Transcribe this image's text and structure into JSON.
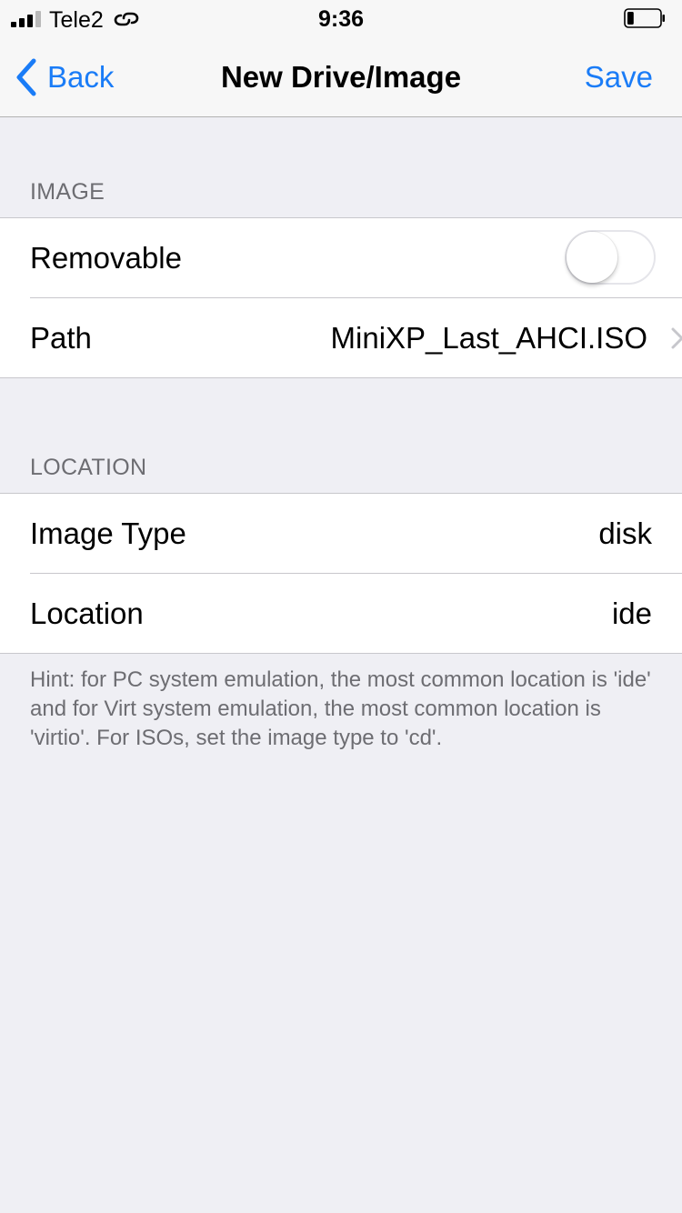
{
  "status_bar": {
    "carrier": "Tele2",
    "time": "9:36",
    "signal_bars": 4,
    "signal_active": 3,
    "battery_level": 0.2,
    "icons": [
      "signal-icon",
      "link-icon",
      "battery-icon"
    ]
  },
  "nav": {
    "back_label": "Back",
    "title": "New Drive/Image",
    "save_label": "Save",
    "accent_color": "#1a7cf7"
  },
  "image_section": {
    "header": "IMAGE",
    "removable_label": "Removable",
    "removable_on": false,
    "path_label": "Path",
    "path_value": "MiniXP_Last_AHCI.ISO"
  },
  "location_section": {
    "header": "LOCATION",
    "image_type_label": "Image Type",
    "image_type_value": "disk",
    "location_label": "Location",
    "location_value": "ide",
    "hint": "Hint: for PC system emulation, the most common location is 'ide' and for Virt system emulation, the most common location is 'virtio'. For ISOs, set the image type to 'cd'."
  }
}
